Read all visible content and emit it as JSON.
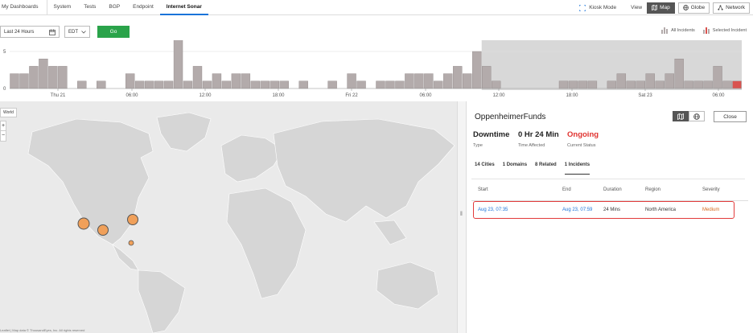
{
  "nav": {
    "items": [
      "My Dashboards",
      "System",
      "Tests",
      "BGP",
      "Endpoint",
      "Internet Sonar"
    ],
    "active": "Internet Sonar",
    "kiosk_label": "Kiosk Mode",
    "view_label": "View",
    "views": [
      "Map",
      "Globe",
      "Network"
    ],
    "active_view": "Map"
  },
  "controls": {
    "time_range": "Last 24 Hours",
    "timezone": "EDT",
    "go_label": "Go",
    "legend_all": "All Incidents",
    "legend_selected": "Selected Incident"
  },
  "timeline": {
    "y_ticks": [
      "5",
      "0"
    ],
    "x_labels": [
      "Thu 21",
      "06:00",
      "12:00",
      "18:00",
      "Fri 22",
      "06:00",
      "12:00",
      "18:00",
      "Sat 23",
      "06:00"
    ],
    "counts": [
      2,
      2,
      3,
      4,
      3,
      3,
      0,
      1,
      0,
      1,
      0,
      0,
      2,
      1,
      1,
      1,
      1,
      7,
      1,
      3,
      1,
      2,
      1,
      2,
      2,
      1,
      1,
      1,
      1,
      0,
      1,
      0,
      0,
      1,
      0,
      2,
      1,
      0,
      1,
      1,
      1,
      2,
      2,
      2,
      1,
      2,
      3,
      2,
      5,
      3,
      1,
      0,
      0,
      0,
      0,
      0,
      0,
      1,
      1,
      1,
      1,
      0,
      1,
      2,
      1,
      1,
      2,
      1,
      2,
      4,
      1,
      1,
      1,
      3,
      1,
      1
    ],
    "selected_index": 75,
    "selection_start_index": 49
  },
  "map": {
    "region_tag": "World",
    "zoom_in": "+",
    "zoom_out": "−",
    "credit": "Leaflet | Map data © ThousandEyes, Inc. All rights reserved"
  },
  "panel": {
    "title": "OppenheimerFunds",
    "close_label": "Close",
    "type_value": "Downtime",
    "type_label": "Type",
    "time_value": "0 Hr 24 Min",
    "time_label": "Time Affected",
    "status_value": "Ongoing",
    "status_label": "Current Status",
    "tabs": [
      "14 Cities",
      "1 Domains",
      "8 Related",
      "1 Incidents"
    ],
    "active_tab": "1 Incidents",
    "columns": [
      "Start",
      "End",
      "Duration",
      "Region",
      "Severity"
    ],
    "rows": [
      {
        "start": "Aug 23, 07:35",
        "end": "Aug 23, 07:59",
        "duration": "24 Mins",
        "region": "North America",
        "severity": "Medium"
      }
    ]
  },
  "colors": {
    "accent": "#1a73d9",
    "go": "#2aa34a",
    "bar": "#b3abab",
    "selected_bar": "#d9534f",
    "ongoing": "#e0322f",
    "severity_medium": "#d6691e",
    "marker": "#f0a05a"
  }
}
